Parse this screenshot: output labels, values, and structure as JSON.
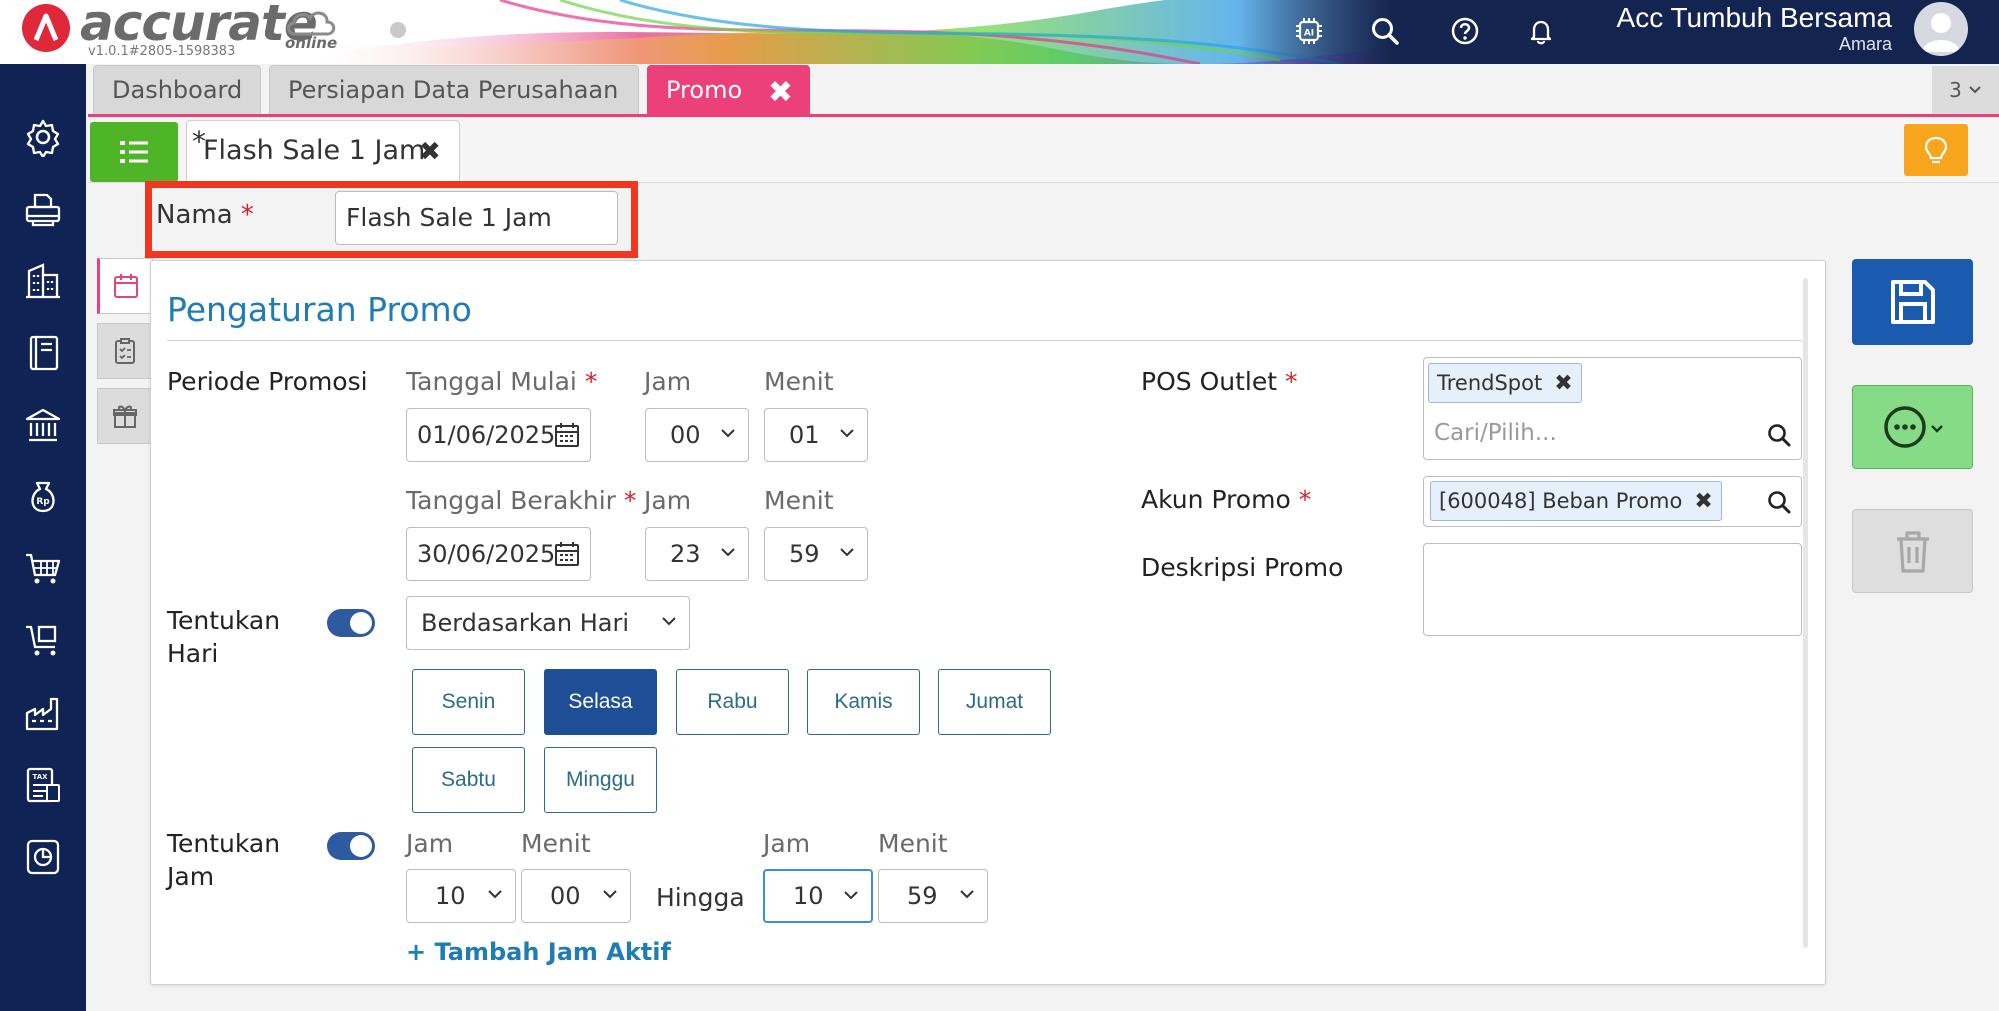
{
  "app": {
    "logo_text": "accurate",
    "logo_sub": "online",
    "version": "v1.0.1#2805-1598383",
    "company": "Acc Tumbuh Bersama",
    "user": "Amara",
    "header_icons": [
      "ai-chip-icon",
      "search-icon",
      "help-icon",
      "bell-icon"
    ]
  },
  "sidebar": {
    "items": [
      "gear-icon",
      "printer-icon",
      "building-icon",
      "ledger-icon",
      "bank-icon",
      "money-bag-icon",
      "cart-icon",
      "cart-return-icon",
      "factory-icon",
      "tax-icon",
      "report-icon"
    ]
  },
  "tabs": [
    {
      "label": "Dashboard"
    },
    {
      "label": "Persiapan Data Perusahaan"
    },
    {
      "label": "Promo",
      "close": "✖"
    }
  ],
  "tabs_count": "3",
  "doc_tab": {
    "modified_mark": "*",
    "title": "Flash Sale 1 Jam",
    "close": "✖"
  },
  "form": {
    "nama_label": "Nama",
    "required_mark": "*",
    "nama_value": "Flash Sale 1 Jam",
    "section_title": "Pengaturan Promo",
    "periode_label": "Periode Promosi",
    "tanggal_mulai_label": "Tanggal Mulai",
    "tanggal_mulai_value": "01/06/2025",
    "jam_label": "Jam",
    "menit_label": "Menit",
    "mulai_jam": "00",
    "mulai_menit": "01",
    "tanggal_berakhir_label": "Tanggal Berakhir",
    "tanggal_berakhir_value": "30/06/2025",
    "berakhir_jam": "23",
    "berakhir_menit": "59",
    "tentukan_hari_label_1": "Tentukan",
    "tentukan_hari_label_2": "Hari",
    "hari_mode": "Berdasarkan Hari",
    "days": [
      "Senin",
      "Selasa",
      "Rabu",
      "Kamis",
      "Jumat",
      "Sabtu",
      "Minggu"
    ],
    "selected_day": "Selasa",
    "tentukan_jam_label_1": "Tentukan",
    "tentukan_jam_label_2": "Jam",
    "jam_dari": "10",
    "menit_dari": "00",
    "hingga_label": "Hingga",
    "jam_hingga": "10",
    "menit_hingga": "59",
    "add_jam_link": "+ Tambah Jam Aktif",
    "pos_outlet_label": "POS Outlet",
    "pos_outlet_chip": "TrendSpot",
    "pos_outlet_placeholder": "Cari/Pilih...",
    "akun_promo_label": "Akun Promo",
    "akun_promo_chip": "[600048] Beban Promo",
    "deskripsi_label": "Deskripsi Promo",
    "deskripsi_value": ""
  },
  "colors": {
    "primary_nav": "#0f2354",
    "tab_active": "#ec407a",
    "save": "#1a5bb0",
    "more": "#86dc86",
    "selected_day": "#1d4e96",
    "highlight_box": "#f0361e"
  }
}
